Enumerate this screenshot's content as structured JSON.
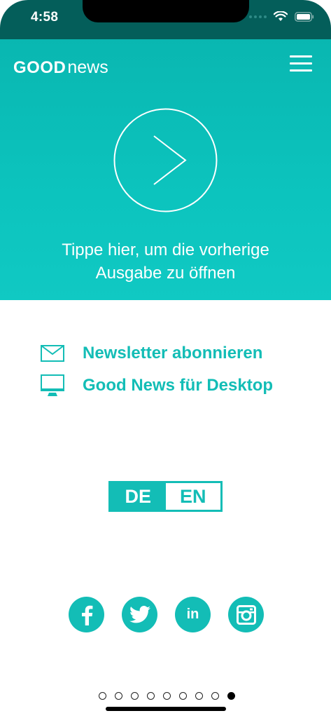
{
  "status_bar": {
    "time": "4:58"
  },
  "header": {
    "logo_good": "GOOD",
    "logo_news": "news",
    "prompt_line1": "Tippe hier, um die vorherige",
    "prompt_line2": "Ausgabe zu öffnen"
  },
  "links": {
    "newsletter": "Newsletter abonnieren",
    "desktop": "Good News für Desktop"
  },
  "language": {
    "de": "DE",
    "en": "EN",
    "selected": "DE"
  },
  "social": [
    "facebook-icon",
    "twitter-icon",
    "linkedin-icon",
    "instagram-icon"
  ],
  "social_labels": {
    "linkedin": "in"
  },
  "pagination": {
    "total": 9,
    "current": 9
  },
  "colors": {
    "brand": "#13bdb6",
    "status_bar": "#045e5a",
    "header_bg": "#0cc4be"
  }
}
